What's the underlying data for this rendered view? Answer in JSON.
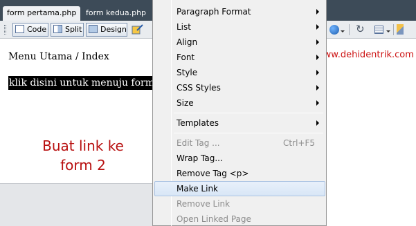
{
  "tabs": [
    {
      "label": "form pertama.php"
    },
    {
      "label": "form kedua.php"
    }
  ],
  "toolbar": {
    "code_label": "Code",
    "split_label": "Split",
    "design_label": "Design"
  },
  "document": {
    "heading": "Menu Utama / Index",
    "selected_text": "klik disini untuk menuju form ke dua"
  },
  "annotation": {
    "line1": "Buat link ke",
    "line2": "form 2"
  },
  "watermark": "www.dehidentrik.com",
  "context_menu": {
    "items": [
      {
        "label": "Paragraph Format",
        "submenu": true
      },
      {
        "label": "List",
        "submenu": true
      },
      {
        "label": "Align",
        "submenu": true
      },
      {
        "label": "Font",
        "submenu": true
      },
      {
        "label": "Style",
        "submenu": true
      },
      {
        "label": "CSS Styles",
        "submenu": true
      },
      {
        "label": "Size",
        "submenu": true
      },
      {
        "label": "Templates",
        "submenu": true
      },
      {
        "label": "Edit Tag ...",
        "shortcut": "Ctrl+F5",
        "disabled": true
      },
      {
        "label": "Wrap Tag..."
      },
      {
        "label": "Remove Tag <p>"
      },
      {
        "label": "Make Link",
        "highlighted": true
      },
      {
        "label": "Remove Link",
        "disabled": true
      },
      {
        "label": "Open Linked Page",
        "disabled": true
      }
    ]
  },
  "colors": {
    "tab_bar": "#3d4b58",
    "menu_highlight": "#d8e6f6",
    "annotation_red": "#b80f0f",
    "watermark_red": "#cc1111"
  },
  "icons": [
    "code-view-icon",
    "split-view-icon",
    "design-view-icon",
    "live-view-icon",
    "globe-icon",
    "refresh-icon",
    "visual-aids-icon",
    "pen-icon"
  ]
}
